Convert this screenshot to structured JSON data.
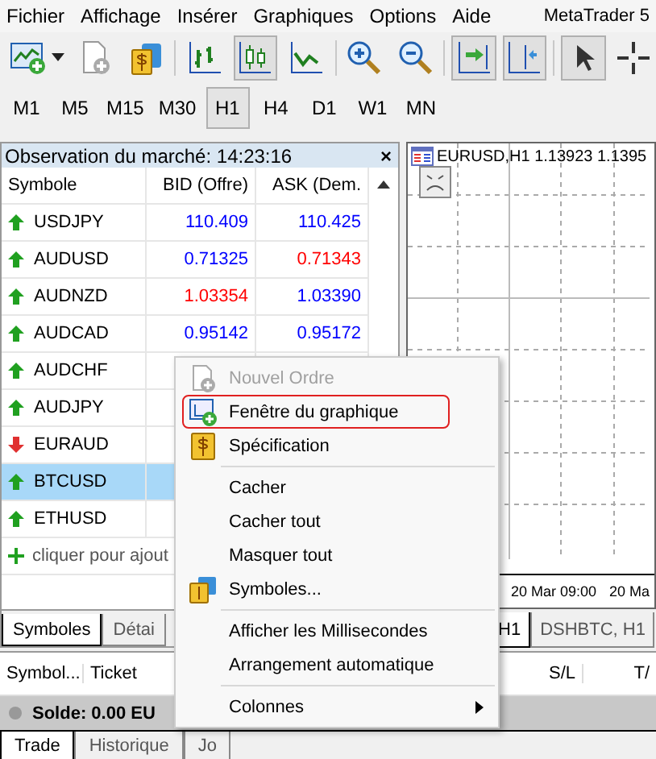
{
  "menubar": {
    "items": [
      "Fichier",
      "Affichage",
      "Insérer",
      "Graphiques",
      "Options",
      "Aide"
    ],
    "app_title": "MetaTrader 5"
  },
  "toolbar": [
    {
      "kind": "new-chart",
      "pressed": false
    },
    {
      "kind": "dropdown",
      "pressed": false
    },
    {
      "kind": "new-doc",
      "pressed": false
    },
    {
      "kind": "money",
      "pressed": false
    },
    {
      "kind": "sep"
    },
    {
      "kind": "bars",
      "pressed": false
    },
    {
      "kind": "candles",
      "pressed": true
    },
    {
      "kind": "line",
      "pressed": false
    },
    {
      "kind": "sep"
    },
    {
      "kind": "zoom-in",
      "pressed": false
    },
    {
      "kind": "zoom-out",
      "pressed": false
    },
    {
      "kind": "sep"
    },
    {
      "kind": "scroll",
      "pressed": true
    },
    {
      "kind": "shift",
      "pressed": true
    },
    {
      "kind": "sep"
    },
    {
      "kind": "cursor",
      "pressed": true
    },
    {
      "kind": "crosshair",
      "pressed": false
    }
  ],
  "timeframes": [
    {
      "label": "M1",
      "selected": false
    },
    {
      "label": "M5",
      "selected": false
    },
    {
      "label": "M15",
      "selected": false
    },
    {
      "label": "M30",
      "selected": false
    },
    {
      "label": "H1",
      "selected": true
    },
    {
      "label": "H4",
      "selected": false
    },
    {
      "label": "D1",
      "selected": false
    },
    {
      "label": "W1",
      "selected": false
    },
    {
      "label": "MN",
      "selected": false
    }
  ],
  "market_watch": {
    "title": "Observation du marché: 14:23:16",
    "close": "×",
    "columns": [
      "Symbole",
      "BID (Offre)",
      "ASK (Dem."
    ],
    "rows": [
      {
        "symbol": "USDJPY",
        "rising": true,
        "selected": false,
        "bid": {
          "value": "110.409",
          "color": "#0000ff"
        },
        "ask": {
          "value": "110.425",
          "color": "#0000ff"
        }
      },
      {
        "symbol": "AUDUSD",
        "rising": true,
        "selected": false,
        "bid": {
          "value": "0.71325",
          "color": "#0000ff"
        },
        "ask": {
          "value": "0.71343",
          "color": "#ff0000"
        }
      },
      {
        "symbol": "AUDNZD",
        "rising": true,
        "selected": false,
        "bid": {
          "value": "1.03354",
          "color": "#ff0000"
        },
        "ask": {
          "value": "1.03390",
          "color": "#0000ff"
        }
      },
      {
        "symbol": "AUDCAD",
        "rising": true,
        "selected": false,
        "bid": {
          "value": "0.95142",
          "color": "#0000ff"
        },
        "ask": {
          "value": "0.95172",
          "color": "#0000ff"
        }
      },
      {
        "symbol": "AUDCHF",
        "rising": true,
        "selected": false
      },
      {
        "symbol": "AUDJPY",
        "rising": true,
        "selected": false
      },
      {
        "symbol": "EURAUD",
        "rising": false,
        "selected": false
      },
      {
        "symbol": "BTCUSD",
        "rising": true,
        "selected": true
      },
      {
        "symbol": "ETHUSD",
        "rising": true,
        "selected": false
      }
    ],
    "add_row": "cliquer pour ajout",
    "tabs": [
      {
        "label": "Symboles",
        "selected": true
      },
      {
        "label": "Détai",
        "selected": false
      }
    ]
  },
  "chart": {
    "title": "EURUSD,H1  1.13923 1.1395",
    "time_labels": [
      "20 Mar 09:00",
      "20 Ma"
    ],
    "tabs": [
      {
        "label": "H1",
        "selected": true
      },
      {
        "label": "DSHBTC, H1",
        "selected": false
      }
    ]
  },
  "toolbox": {
    "columns": [
      "Symbol...",
      "Ticket",
      "S/L",
      "T/"
    ],
    "balance": "Solde: 0.00 EU",
    "tabs": [
      {
        "label": "Trade",
        "selected": true
      },
      {
        "label": "Historique",
        "selected": false
      },
      {
        "label": "Jo",
        "selected": false
      }
    ]
  },
  "context_menu": [
    {
      "kind": "new-order",
      "label": "Nouvel Ordre",
      "disabled": true,
      "highlighted": false
    },
    {
      "kind": "chart-window",
      "label": "Fenêtre du graphique",
      "disabled": false,
      "highlighted": true
    },
    {
      "kind": "spec",
      "label": "Spécification",
      "disabled": false,
      "highlighted": false
    },
    {
      "kind": "separator"
    },
    {
      "kind": "plain",
      "label": "Cacher",
      "disabled": false,
      "highlighted": false
    },
    {
      "kind": "plain",
      "label": "Cacher tout",
      "disabled": false,
      "highlighted": false
    },
    {
      "kind": "plain",
      "label": "Masquer tout",
      "disabled": false,
      "highlighted": false
    },
    {
      "kind": "symbols",
      "label": "Symboles...",
      "disabled": false,
      "highlighted": false
    },
    {
      "kind": "separator"
    },
    {
      "kind": "plain",
      "label": "Afficher les Millisecondes",
      "disabled": false,
      "highlighted": false
    },
    {
      "kind": "plain",
      "label": "Arrangement automatique",
      "disabled": false,
      "highlighted": false
    },
    {
      "kind": "separator"
    },
    {
      "kind": "submenu",
      "label": "Colonnes",
      "disabled": false,
      "highlighted": false
    }
  ]
}
